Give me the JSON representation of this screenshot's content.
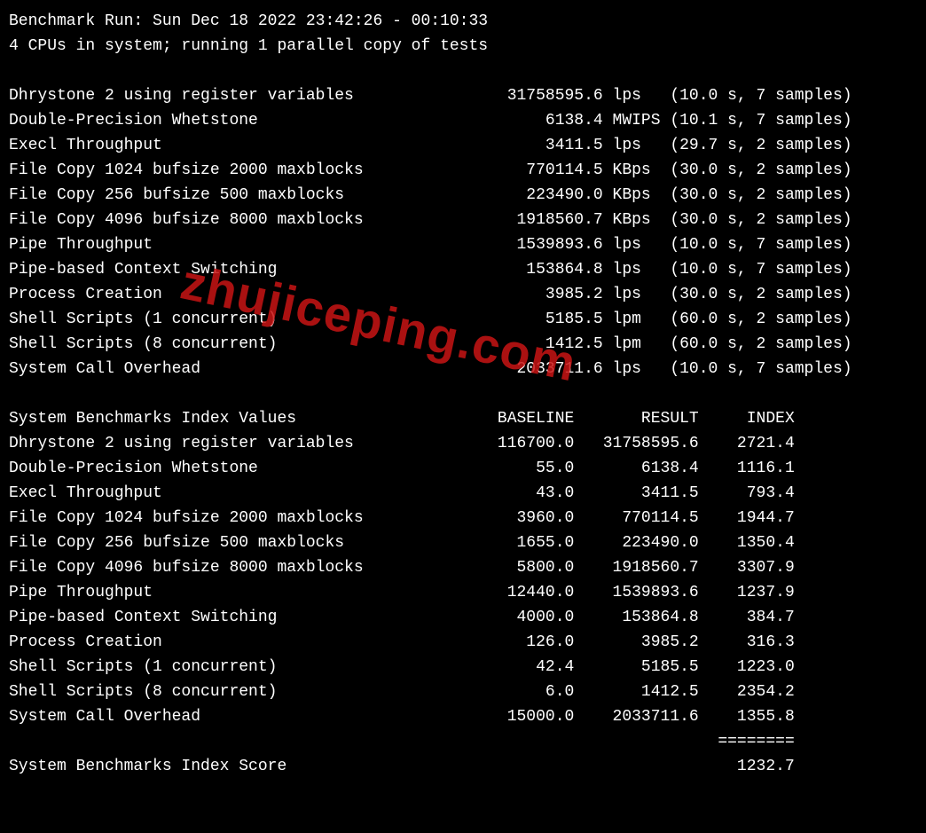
{
  "header": {
    "run_line": "Benchmark Run: Sun Dec 18 2022 23:42:26 - 00:10:33",
    "cpu_line": "4 CPUs in system; running 1 parallel copy of tests"
  },
  "watermark": "zhujiceping.com",
  "tests": [
    {
      "name": "Dhrystone 2 using register variables",
      "value": "31758595.6",
      "unit": "lps",
      "time": "10.0",
      "samples": "7"
    },
    {
      "name": "Double-Precision Whetstone",
      "value": "6138.4",
      "unit": "MWIPS",
      "time": "10.1",
      "samples": "7"
    },
    {
      "name": "Execl Throughput",
      "value": "3411.5",
      "unit": "lps",
      "time": "29.7",
      "samples": "2"
    },
    {
      "name": "File Copy 1024 bufsize 2000 maxblocks",
      "value": "770114.5",
      "unit": "KBps",
      "time": "30.0",
      "samples": "2"
    },
    {
      "name": "File Copy 256 bufsize 500 maxblocks",
      "value": "223490.0",
      "unit": "KBps",
      "time": "30.0",
      "samples": "2"
    },
    {
      "name": "File Copy 4096 bufsize 8000 maxblocks",
      "value": "1918560.7",
      "unit": "KBps",
      "time": "30.0",
      "samples": "2"
    },
    {
      "name": "Pipe Throughput",
      "value": "1539893.6",
      "unit": "lps",
      "time": "10.0",
      "samples": "7"
    },
    {
      "name": "Pipe-based Context Switching",
      "value": "153864.8",
      "unit": "lps",
      "time": "10.0",
      "samples": "7"
    },
    {
      "name": "Process Creation",
      "value": "3985.2",
      "unit": "lps",
      "time": "30.0",
      "samples": "2"
    },
    {
      "name": "Shell Scripts (1 concurrent)",
      "value": "5185.5",
      "unit": "lpm",
      "time": "60.0",
      "samples": "2"
    },
    {
      "name": "Shell Scripts (8 concurrent)",
      "value": "1412.5",
      "unit": "lpm",
      "time": "60.0",
      "samples": "2"
    },
    {
      "name": "System Call Overhead",
      "value": "2033711.6",
      "unit": "lps",
      "time": "10.0",
      "samples": "7"
    }
  ],
  "index_header": {
    "title": "System Benchmarks Index Values",
    "baseline": "BASELINE",
    "result": "RESULT",
    "index": "INDEX"
  },
  "index_rows": [
    {
      "name": "Dhrystone 2 using register variables",
      "baseline": "116700.0",
      "result": "31758595.6",
      "index": "2721.4"
    },
    {
      "name": "Double-Precision Whetstone",
      "baseline": "55.0",
      "result": "6138.4",
      "index": "1116.1"
    },
    {
      "name": "Execl Throughput",
      "baseline": "43.0",
      "result": "3411.5",
      "index": "793.4"
    },
    {
      "name": "File Copy 1024 bufsize 2000 maxblocks",
      "baseline": "3960.0",
      "result": "770114.5",
      "index": "1944.7"
    },
    {
      "name": "File Copy 256 bufsize 500 maxblocks",
      "baseline": "1655.0",
      "result": "223490.0",
      "index": "1350.4"
    },
    {
      "name": "File Copy 4096 bufsize 8000 maxblocks",
      "baseline": "5800.0",
      "result": "1918560.7",
      "index": "3307.9"
    },
    {
      "name": "Pipe Throughput",
      "baseline": "12440.0",
      "result": "1539893.6",
      "index": "1237.9"
    },
    {
      "name": "Pipe-based Context Switching",
      "baseline": "4000.0",
      "result": "153864.8",
      "index": "384.7"
    },
    {
      "name": "Process Creation",
      "baseline": "126.0",
      "result": "3985.2",
      "index": "316.3"
    },
    {
      "name": "Shell Scripts (1 concurrent)",
      "baseline": "42.4",
      "result": "5185.5",
      "index": "1223.0"
    },
    {
      "name": "Shell Scripts (8 concurrent)",
      "baseline": "6.0",
      "result": "1412.5",
      "index": "2354.2"
    },
    {
      "name": "System Call Overhead",
      "baseline": "15000.0",
      "result": "2033711.6",
      "index": "1355.8"
    }
  ],
  "score": {
    "label": "System Benchmarks Index Score",
    "value": "1232.7"
  },
  "divider": "========"
}
